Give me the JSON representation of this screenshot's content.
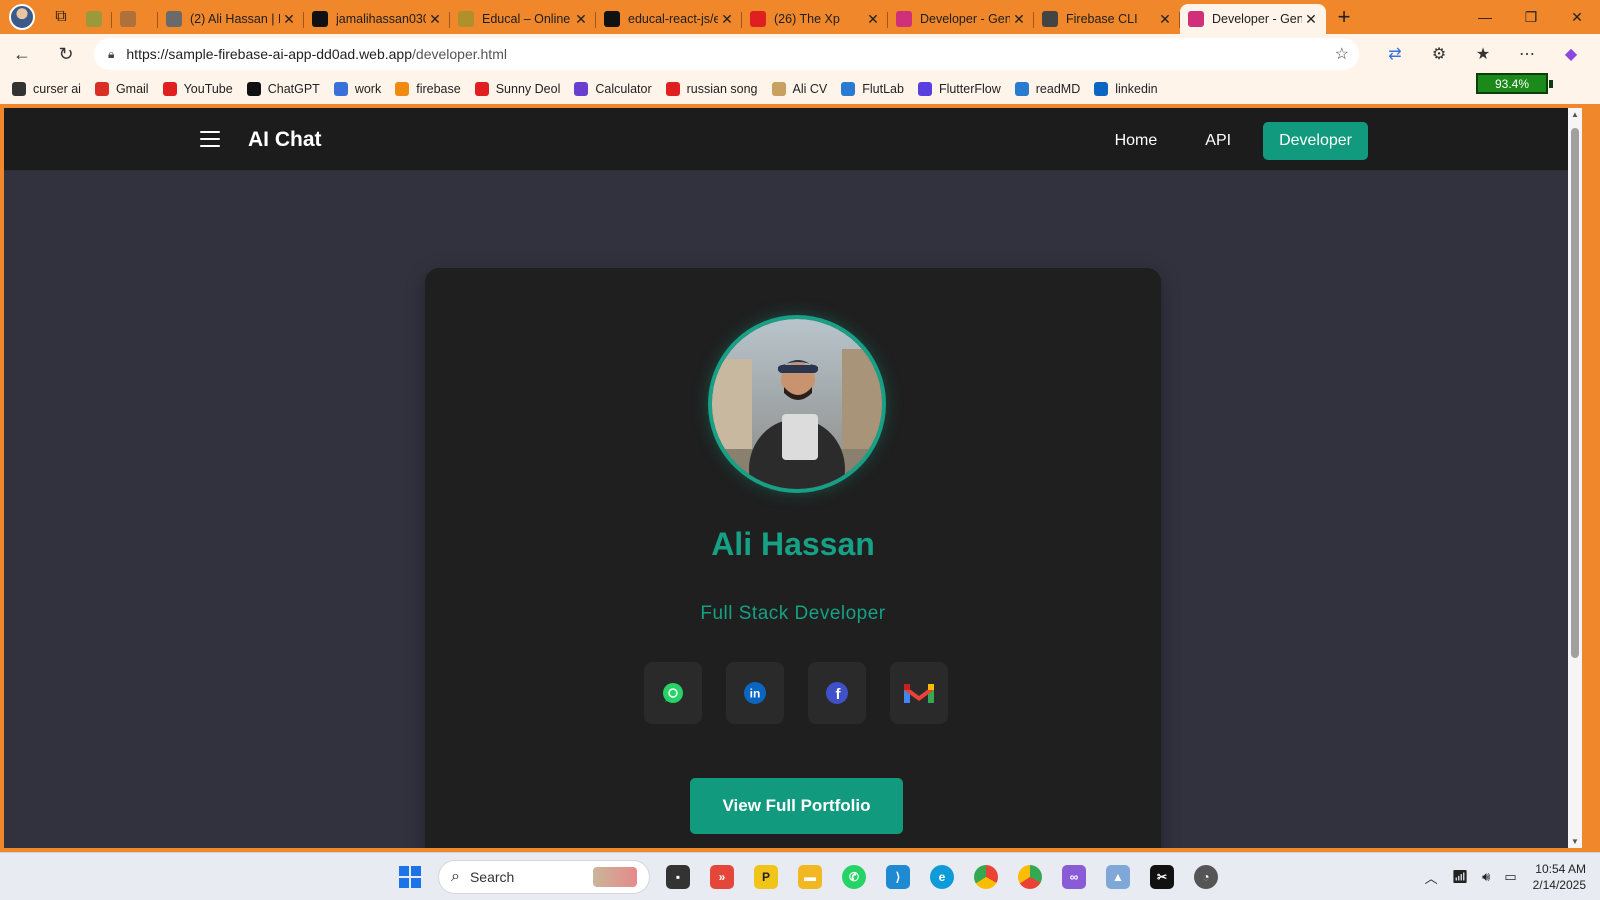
{
  "browser": {
    "tabs": [
      {
        "title": "",
        "favicon": "wp-icon",
        "color": "#9a9a3a",
        "active": false
      },
      {
        "title": "",
        "favicon": "record-icon",
        "color": "#b0703a",
        "active": false
      },
      {
        "title": "(2) Ali Hassan | L",
        "favicon": "linkedin-icon",
        "color": "#6a6a6a",
        "active": false
      },
      {
        "title": "jamalihassan030",
        "favicon": "github-icon",
        "color": "#111111",
        "active": false
      },
      {
        "title": "Educal – Online",
        "favicon": "educal-icon",
        "color": "#b0902a",
        "active": false
      },
      {
        "title": "educal-react-js/e",
        "favicon": "github-icon",
        "color": "#111111",
        "active": false
      },
      {
        "title": "(26) The Xp",
        "favicon": "youtube-icon",
        "color": "#e02020",
        "active": false
      },
      {
        "title": "Developer - Gen",
        "favicon": "angular-icon",
        "color": "#d0307a",
        "active": false
      },
      {
        "title": "Firebase CLI",
        "favicon": "globe-icon",
        "color": "#444444",
        "active": false
      },
      {
        "title": "Developer - Gen",
        "favicon": "angular-icon",
        "color": "#d0307a",
        "active": true
      }
    ],
    "url_host": "https://sample-firebase-ai-app-dd0ad.web.app",
    "url_path": "/developer.html",
    "battery": "93.4%"
  },
  "bookmarks": [
    {
      "label": "curser ai",
      "color": "#333333"
    },
    {
      "label": "Gmail",
      "color": "#d93025"
    },
    {
      "label": "YouTube",
      "color": "#e02020"
    },
    {
      "label": "ChatGPT",
      "color": "#111111"
    },
    {
      "label": "work",
      "color": "#3b6fd9"
    },
    {
      "label": "firebase",
      "color": "#f08a10"
    },
    {
      "label": "Sunny Deol",
      "color": "#e02020"
    },
    {
      "label": "Calculator",
      "color": "#6a3fd0"
    },
    {
      "label": "russian song",
      "color": "#e02020"
    },
    {
      "label": "Ali CV",
      "color": "#c8a060"
    },
    {
      "label": "FlutLab",
      "color": "#2a7ad0"
    },
    {
      "label": "FlutterFlow",
      "color": "#5a3fe0"
    },
    {
      "label": "readMD",
      "color": "#2a7ad0"
    },
    {
      "label": "linkedin",
      "color": "#0a66c2"
    }
  ],
  "site": {
    "brand": "AI Chat",
    "nav": {
      "home": "Home",
      "api": "API",
      "developer": "Developer"
    },
    "accent": "#129a7e",
    "profile": {
      "name": "Ali Hassan",
      "role": "Full Stack Developer",
      "socials": [
        "whatsapp-icon",
        "linkedin-icon",
        "facebook-icon",
        "gmail-icon"
      ],
      "portfolio_button": "View Full Portfolio"
    }
  },
  "taskbar": {
    "search_placeholder": "Search",
    "time": "10:54 AM",
    "date": "2/14/2025"
  }
}
